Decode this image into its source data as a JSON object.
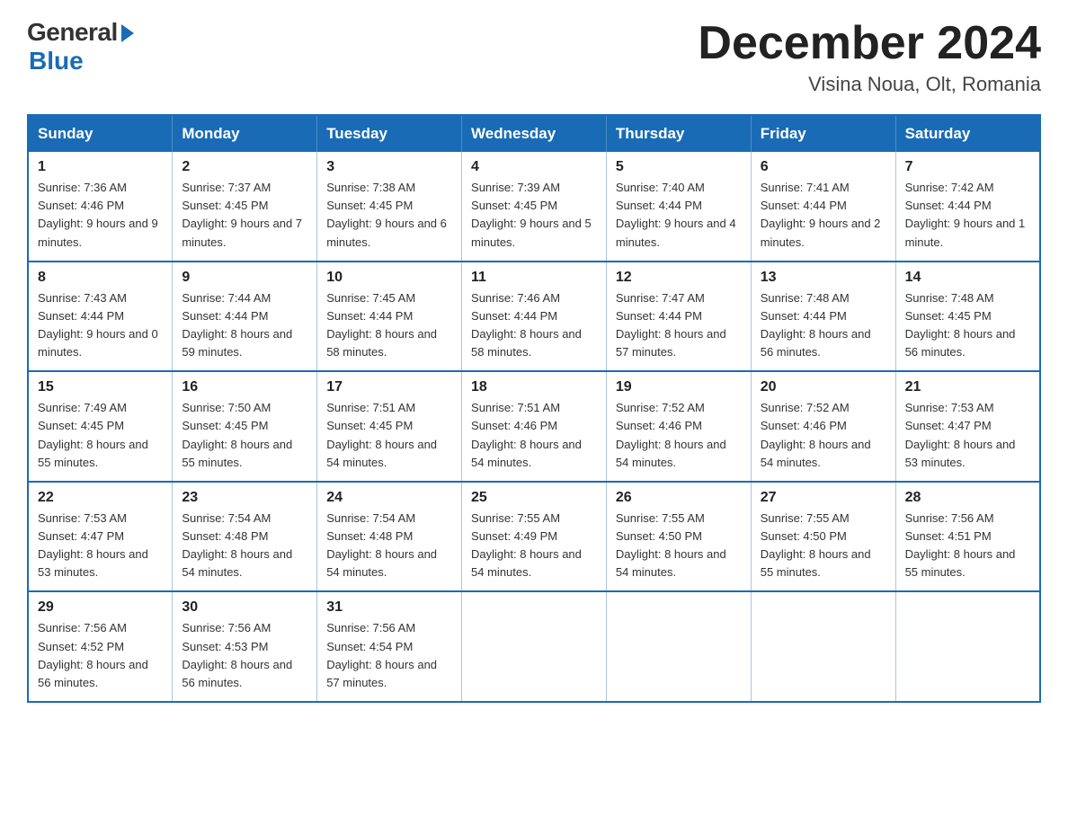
{
  "logo": {
    "general": "General",
    "blue": "Blue"
  },
  "title": "December 2024",
  "location": "Visina Noua, Olt, Romania",
  "weekdays": [
    "Sunday",
    "Monday",
    "Tuesday",
    "Wednesday",
    "Thursday",
    "Friday",
    "Saturday"
  ],
  "weeks": [
    [
      {
        "day": "1",
        "sunrise": "7:36 AM",
        "sunset": "4:46 PM",
        "daylight": "9 hours and 9 minutes."
      },
      {
        "day": "2",
        "sunrise": "7:37 AM",
        "sunset": "4:45 PM",
        "daylight": "9 hours and 7 minutes."
      },
      {
        "day": "3",
        "sunrise": "7:38 AM",
        "sunset": "4:45 PM",
        "daylight": "9 hours and 6 minutes."
      },
      {
        "day": "4",
        "sunrise": "7:39 AM",
        "sunset": "4:45 PM",
        "daylight": "9 hours and 5 minutes."
      },
      {
        "day": "5",
        "sunrise": "7:40 AM",
        "sunset": "4:44 PM",
        "daylight": "9 hours and 4 minutes."
      },
      {
        "day": "6",
        "sunrise": "7:41 AM",
        "sunset": "4:44 PM",
        "daylight": "9 hours and 2 minutes."
      },
      {
        "day": "7",
        "sunrise": "7:42 AM",
        "sunset": "4:44 PM",
        "daylight": "9 hours and 1 minute."
      }
    ],
    [
      {
        "day": "8",
        "sunrise": "7:43 AM",
        "sunset": "4:44 PM",
        "daylight": "9 hours and 0 minutes."
      },
      {
        "day": "9",
        "sunrise": "7:44 AM",
        "sunset": "4:44 PM",
        "daylight": "8 hours and 59 minutes."
      },
      {
        "day": "10",
        "sunrise": "7:45 AM",
        "sunset": "4:44 PM",
        "daylight": "8 hours and 58 minutes."
      },
      {
        "day": "11",
        "sunrise": "7:46 AM",
        "sunset": "4:44 PM",
        "daylight": "8 hours and 58 minutes."
      },
      {
        "day": "12",
        "sunrise": "7:47 AM",
        "sunset": "4:44 PM",
        "daylight": "8 hours and 57 minutes."
      },
      {
        "day": "13",
        "sunrise": "7:48 AM",
        "sunset": "4:44 PM",
        "daylight": "8 hours and 56 minutes."
      },
      {
        "day": "14",
        "sunrise": "7:48 AM",
        "sunset": "4:45 PM",
        "daylight": "8 hours and 56 minutes."
      }
    ],
    [
      {
        "day": "15",
        "sunrise": "7:49 AM",
        "sunset": "4:45 PM",
        "daylight": "8 hours and 55 minutes."
      },
      {
        "day": "16",
        "sunrise": "7:50 AM",
        "sunset": "4:45 PM",
        "daylight": "8 hours and 55 minutes."
      },
      {
        "day": "17",
        "sunrise": "7:51 AM",
        "sunset": "4:45 PM",
        "daylight": "8 hours and 54 minutes."
      },
      {
        "day": "18",
        "sunrise": "7:51 AM",
        "sunset": "4:46 PM",
        "daylight": "8 hours and 54 minutes."
      },
      {
        "day": "19",
        "sunrise": "7:52 AM",
        "sunset": "4:46 PM",
        "daylight": "8 hours and 54 minutes."
      },
      {
        "day": "20",
        "sunrise": "7:52 AM",
        "sunset": "4:46 PM",
        "daylight": "8 hours and 54 minutes."
      },
      {
        "day": "21",
        "sunrise": "7:53 AM",
        "sunset": "4:47 PM",
        "daylight": "8 hours and 53 minutes."
      }
    ],
    [
      {
        "day": "22",
        "sunrise": "7:53 AM",
        "sunset": "4:47 PM",
        "daylight": "8 hours and 53 minutes."
      },
      {
        "day": "23",
        "sunrise": "7:54 AM",
        "sunset": "4:48 PM",
        "daylight": "8 hours and 54 minutes."
      },
      {
        "day": "24",
        "sunrise": "7:54 AM",
        "sunset": "4:48 PM",
        "daylight": "8 hours and 54 minutes."
      },
      {
        "day": "25",
        "sunrise": "7:55 AM",
        "sunset": "4:49 PM",
        "daylight": "8 hours and 54 minutes."
      },
      {
        "day": "26",
        "sunrise": "7:55 AM",
        "sunset": "4:50 PM",
        "daylight": "8 hours and 54 minutes."
      },
      {
        "day": "27",
        "sunrise": "7:55 AM",
        "sunset": "4:50 PM",
        "daylight": "8 hours and 55 minutes."
      },
      {
        "day": "28",
        "sunrise": "7:56 AM",
        "sunset": "4:51 PM",
        "daylight": "8 hours and 55 minutes."
      }
    ],
    [
      {
        "day": "29",
        "sunrise": "7:56 AM",
        "sunset": "4:52 PM",
        "daylight": "8 hours and 56 minutes."
      },
      {
        "day": "30",
        "sunrise": "7:56 AM",
        "sunset": "4:53 PM",
        "daylight": "8 hours and 56 minutes."
      },
      {
        "day": "31",
        "sunrise": "7:56 AM",
        "sunset": "4:54 PM",
        "daylight": "8 hours and 57 minutes."
      },
      null,
      null,
      null,
      null
    ]
  ]
}
